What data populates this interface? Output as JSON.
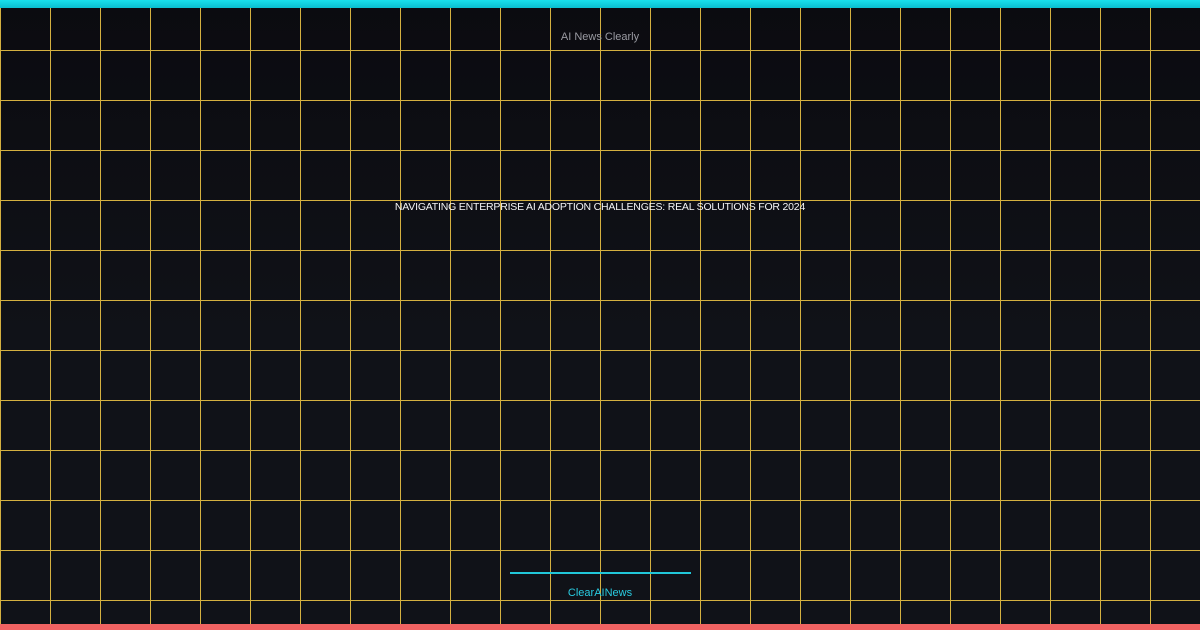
{
  "site": {
    "name": "AI News Clearly"
  },
  "article": {
    "headline": "NAVIGATING ENTERPRISE AI ADOPTION CHALLENGES: REAL SOLUTIONS FOR 2024"
  },
  "brand": {
    "name": "ClearAINews"
  },
  "colors": {
    "background": "#0c0d12",
    "grid": "#d4b040",
    "top_bar": "#18e0ec",
    "bottom_bar": "#f06262",
    "accent": "#21c7d8",
    "headline_text": "#f4f4f6",
    "site_name_text": "#9a9ba2"
  }
}
